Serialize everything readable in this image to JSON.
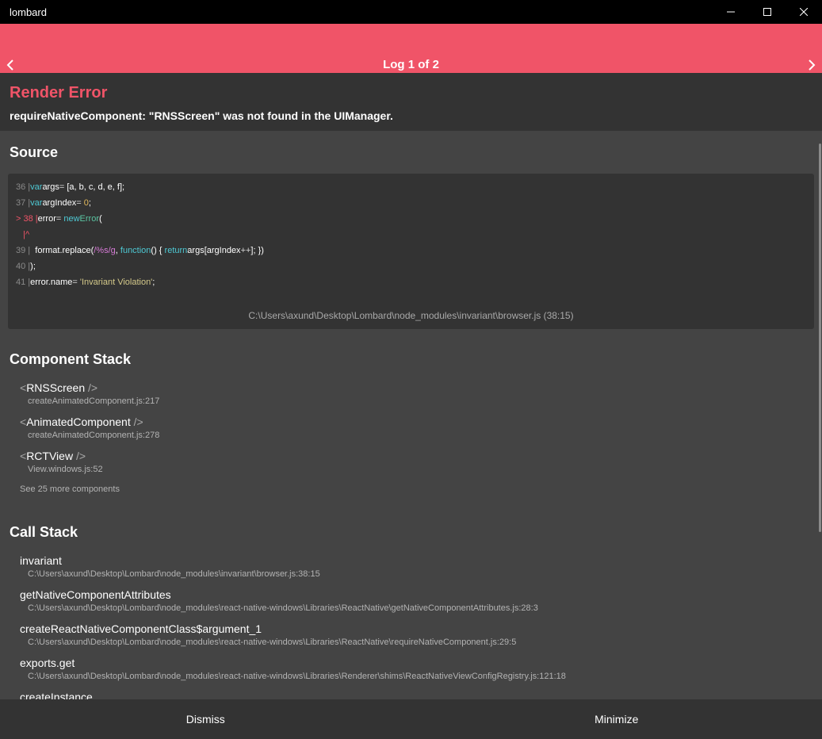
{
  "window": {
    "title": "lombard",
    "minimize_icon": "minimize-icon",
    "maximize_icon": "maximize-icon",
    "close_icon": "close-icon"
  },
  "header": {
    "log_counter": "Log 1 of 2",
    "prev_icon": "chevron-left-icon",
    "next_icon": "chevron-right-icon",
    "bg_color": "#f05468"
  },
  "error": {
    "title": "Render Error",
    "message": "requireNativeComponent: \"RNSScreen\" was not found in the UIManager."
  },
  "source": {
    "heading": "Source",
    "lines": [
      {
        "num": "36",
        "marker": "",
        "parts": [
          [
            "kw",
            "var"
          ],
          [
            "",
            "args"
          ],
          [
            "op",
            "= "
          ],
          [
            "",
            "[a, b, c, d, e, f];"
          ]
        ]
      },
      {
        "num": "37",
        "marker": "",
        "parts": [
          [
            "kw",
            "var"
          ],
          [
            "",
            "argIndex"
          ],
          [
            "op",
            "= "
          ],
          [
            "num",
            "0"
          ],
          [
            "",
            ";"
          ]
        ]
      },
      {
        "num": "38",
        "marker": ">",
        "parts": [
          [
            "",
            "error"
          ],
          [
            "op",
            "= "
          ],
          [
            "kw",
            "new"
          ],
          [
            "ctor",
            "Error"
          ],
          [
            "",
            "("
          ]
        ]
      },
      {
        "num": "",
        "marker": "",
        "caret": "|^",
        "parts": []
      },
      {
        "num": "39",
        "marker": "",
        "parts": [
          [
            "",
            "  format.replace("
          ],
          [
            "re",
            "/%s/g"
          ],
          [
            "",
            ", "
          ],
          [
            "kw",
            "function"
          ],
          [
            "",
            "() { "
          ],
          [
            "kw",
            "return"
          ],
          [
            "",
            "args[argIndex"
          ],
          [
            "op",
            "++"
          ],
          [
            "",
            "]; })"
          ]
        ]
      },
      {
        "num": "40",
        "marker": "",
        "parts": [
          [
            "",
            ");"
          ]
        ]
      },
      {
        "num": "41",
        "marker": "",
        "parts": [
          [
            "",
            "error.name"
          ],
          [
            "op",
            "= "
          ],
          [
            "str",
            "'Invariant Violation'"
          ],
          [
            "",
            ";"
          ]
        ]
      }
    ],
    "file": "C:\\Users\\axund\\Desktop\\Lombard\\node_modules\\invariant\\browser.js (38:15)"
  },
  "component_stack": {
    "heading": "Component Stack",
    "items": [
      {
        "name": "RNSScreen",
        "location": "createAnimatedComponent.js:217"
      },
      {
        "name": "AnimatedComponent",
        "location": "createAnimatedComponent.js:278"
      },
      {
        "name": "RCTView",
        "location": "View.windows.js:52"
      }
    ],
    "open_tag": "<",
    "close_tag": " />",
    "see_more": "See 25 more components"
  },
  "call_stack": {
    "heading": "Call Stack",
    "items": [
      {
        "name": "invariant",
        "location": "C:\\Users\\axund\\Desktop\\Lombard\\node_modules\\invariant\\browser.js:38:15"
      },
      {
        "name": "getNativeComponentAttributes",
        "location": "C:\\Users\\axund\\Desktop\\Lombard\\node_modules\\react-native-windows\\Libraries\\ReactNative\\getNativeComponentAttributes.js:28:3"
      },
      {
        "name": "createReactNativeComponentClass$argument_1",
        "location": "C:\\Users\\axund\\Desktop\\Lombard\\node_modules\\react-native-windows\\Libraries\\ReactNative\\requireNativeComponent.js:29:5"
      },
      {
        "name": "exports.get",
        "location": "C:\\Users\\axund\\Desktop\\Lombard\\node_modules\\react-native-windows\\Libraries\\Renderer\\shims\\ReactNativeViewConfigRegistry.js:121:18"
      },
      {
        "name": "createInstance",
        "location": ""
      }
    ]
  },
  "footer": {
    "dismiss_label": "Dismiss",
    "minimize_label": "Minimize"
  }
}
